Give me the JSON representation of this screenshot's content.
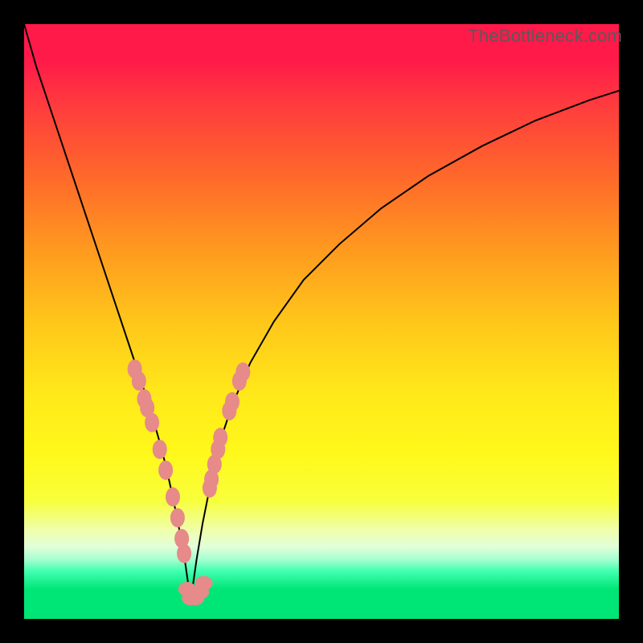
{
  "watermark": "TheBottleneck.com",
  "chart_data": {
    "type": "line",
    "title": "",
    "xlabel": "",
    "ylabel": "",
    "xlim": [
      0,
      100
    ],
    "ylim": [
      0,
      100
    ],
    "left_curve": {
      "x": [
        0,
        2,
        4,
        6,
        8,
        10,
        12,
        14,
        16,
        18,
        19,
        20,
        21,
        22,
        23,
        24,
        25,
        26,
        27,
        28
      ],
      "y": [
        100,
        93,
        87,
        81,
        75,
        69,
        63,
        57,
        51,
        45,
        42,
        39,
        36,
        32.5,
        29,
        25,
        20.5,
        15.5,
        10,
        3
      ]
    },
    "right_curve": {
      "x": [
        28,
        29,
        30,
        31,
        32,
        33,
        35,
        38,
        42,
        47,
        53,
        60,
        68,
        77,
        86,
        95,
        100
      ],
      "y": [
        3,
        10,
        16,
        21,
        26,
        30,
        36,
        43,
        50,
        57,
        63,
        69,
        74.5,
        79.5,
        83.8,
        87.2,
        88.8
      ]
    },
    "markers": {
      "left_branch": [
        {
          "x": 18.6,
          "y": 42
        },
        {
          "x": 19.3,
          "y": 40
        },
        {
          "x": 20.2,
          "y": 37
        },
        {
          "x": 20.7,
          "y": 35.5
        },
        {
          "x": 21.5,
          "y": 33
        },
        {
          "x": 22.8,
          "y": 28.5
        },
        {
          "x": 23.8,
          "y": 25
        },
        {
          "x": 25.0,
          "y": 20.5
        },
        {
          "x": 25.8,
          "y": 17
        },
        {
          "x": 26.5,
          "y": 13.5
        },
        {
          "x": 26.9,
          "y": 11
        }
      ],
      "right_branch": [
        {
          "x": 31.2,
          "y": 22
        },
        {
          "x": 31.5,
          "y": 23.5
        },
        {
          "x": 32.0,
          "y": 26
        },
        {
          "x": 32.6,
          "y": 28.5
        },
        {
          "x": 33.0,
          "y": 30.5
        },
        {
          "x": 34.5,
          "y": 35
        },
        {
          "x": 35.0,
          "y": 36.5
        },
        {
          "x": 36.2,
          "y": 40
        },
        {
          "x": 36.8,
          "y": 41.5
        }
      ],
      "bottom": [
        {
          "x": 27.4,
          "y": 5
        },
        {
          "x": 28.0,
          "y": 3.5
        },
        {
          "x": 28.8,
          "y": 3.5
        },
        {
          "x": 29.6,
          "y": 4.5
        },
        {
          "x": 30.2,
          "y": 6
        }
      ]
    }
  }
}
